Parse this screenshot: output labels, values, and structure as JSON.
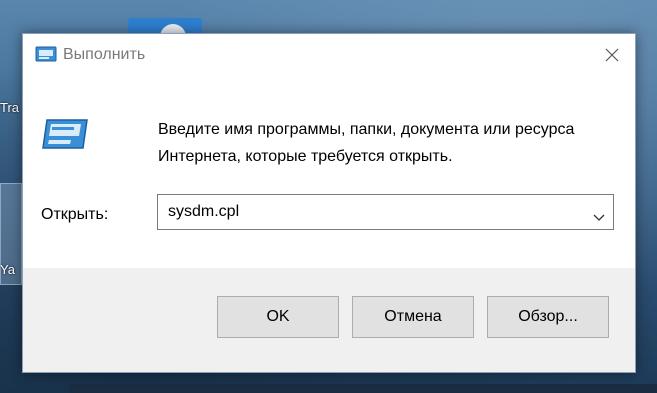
{
  "desktop": {
    "labels": [
      "Tra",
      "Ya"
    ]
  },
  "dialog": {
    "title": "Выполнить",
    "close_label": "✕",
    "description": "Введите имя программы, папки, документа или ресурса Интернета, которые требуется открыть.",
    "open_label": "Открыть:",
    "input_value": "sysdm.cpl",
    "buttons": {
      "ok": "OK",
      "cancel": "Отмена",
      "browse": "Обзор..."
    }
  },
  "colors": {
    "accent_icon": "#3a8fd6",
    "footer_bg": "#f0f0f0",
    "button_bg": "#e1e1e1"
  },
  "icons": [
    "run-icon",
    "close-icon",
    "chevron-down-icon"
  ]
}
